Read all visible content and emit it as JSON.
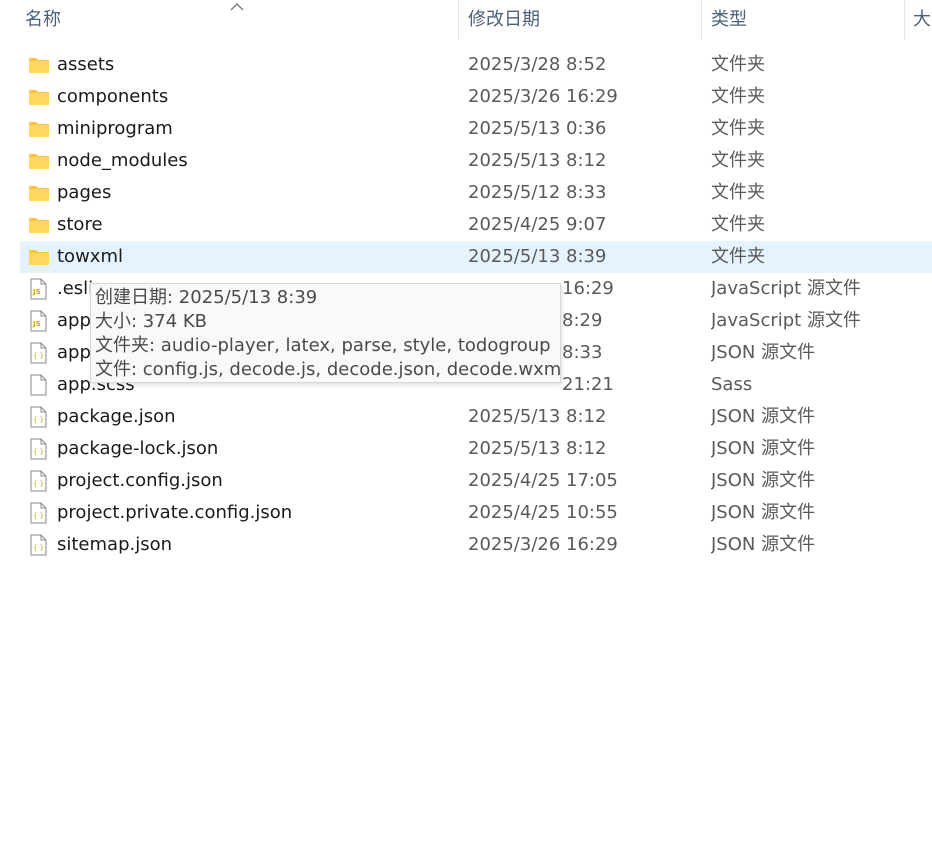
{
  "columns": {
    "name": "名称",
    "date": "修改日期",
    "type": "类型",
    "size": "大"
  },
  "files": [
    {
      "name": "assets",
      "date": "2025/3/28 8:52",
      "type": "文件夹",
      "icon": "folder-icon"
    },
    {
      "name": "components",
      "date": "2025/3/26 16:29",
      "type": "文件夹",
      "icon": "folder-icon"
    },
    {
      "name": "miniprogram",
      "date": "2025/5/13 0:36",
      "type": "文件夹",
      "icon": "folder-icon"
    },
    {
      "name": "node_modules",
      "date": "2025/5/13 8:12",
      "type": "文件夹",
      "icon": "folder-icon"
    },
    {
      "name": "pages",
      "date": "2025/5/12 8:33",
      "type": "文件夹",
      "icon": "folder-icon"
    },
    {
      "name": "store",
      "date": "2025/4/25 9:07",
      "type": "文件夹",
      "icon": "folder-icon"
    },
    {
      "name": "towxml",
      "date": "2025/5/13 8:39",
      "type": "文件夹",
      "icon": "folder-icon"
    },
    {
      "name": ".esli",
      "date": "16:29",
      "type": "JavaScript 源文件",
      "icon": "js-file-icon"
    },
    {
      "name": "app",
      "date": "8:29",
      "type": "JavaScript 源文件",
      "icon": "js-file-icon"
    },
    {
      "name": "app",
      "date": "8:33",
      "type": "JSON 源文件",
      "icon": "json-file-icon"
    },
    {
      "name": "app.scss",
      "date": "21:21",
      "type": "Sass",
      "icon": "blank-file-icon"
    },
    {
      "name": "package.json",
      "date": "2025/5/13 8:12",
      "type": "JSON 源文件",
      "icon": "json-file-icon"
    },
    {
      "name": "package-lock.json",
      "date": "2025/5/13 8:12",
      "type": "JSON 源文件",
      "icon": "json-file-icon"
    },
    {
      "name": "project.config.json",
      "date": "2025/4/25 17:05",
      "type": "JSON 源文件",
      "icon": "json-file-icon"
    },
    {
      "name": "project.private.config.json",
      "date": "2025/4/25 10:55",
      "type": "JSON 源文件",
      "icon": "json-file-icon"
    },
    {
      "name": "sitemap.json",
      "date": "2025/3/26 16:29",
      "type": "JSON 源文件",
      "icon": "json-file-icon"
    }
  ],
  "tooltip": {
    "created": "创建日期: 2025/5/13 8:39",
    "size": "大小: 374 KB",
    "folders": "文件夹: audio-player, latex, parse, style, todogroup",
    "files": "文件: config.js, decode.js, decode.json, decode.wxml, ..."
  },
  "colors": {
    "selected_row": "#e5f3ff",
    "header_text": "#4c607a",
    "folder": "#ffd75e"
  }
}
